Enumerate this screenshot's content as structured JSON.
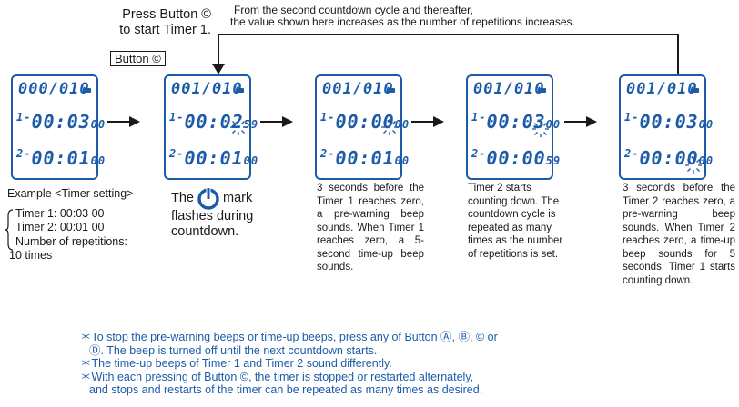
{
  "top": {
    "press_line1": "Press Button ©",
    "press_line2": "to start Timer 1.",
    "button_box": "Button ©",
    "note_line1": "From the second countdown cycle and thereafter,",
    "note_line2": "the value shown here increases as the number of repetitions increases."
  },
  "displays": [
    {
      "row1": "000/010",
      "row2_prefix": "1-",
      "row2_main": "00:03",
      "row2_sub": "00",
      "row3_prefix": "2-",
      "row3_main": "00:01",
      "row3_sub": "00"
    },
    {
      "row1": "001/010",
      "row2_prefix": "1-",
      "row2_main": "00:02",
      "row2_sub": "59",
      "row3_prefix": "2-",
      "row3_main": "00:01",
      "row3_sub": "00"
    },
    {
      "row1": "001/010",
      "row2_prefix": "1-",
      "row2_main": "00:00",
      "row2_sub": "00",
      "row3_prefix": "2-",
      "row3_main": "00:01",
      "row3_sub": "00"
    },
    {
      "row1": "001/010",
      "row2_prefix": "1-",
      "row2_main": "00:03",
      "row2_sub": "00",
      "row3_prefix": "2-",
      "row3_main": "00:00",
      "row3_sub": "59"
    },
    {
      "row1": "001/010",
      "row2_prefix": "1-",
      "row2_main": "00:03",
      "row2_sub": "00",
      "row3_prefix": "2-",
      "row3_main": "00:00",
      "row3_sub": "00"
    }
  ],
  "example": {
    "title": "Example <Timer setting>",
    "lines": [
      "Timer 1: 00:03 00",
      "Timer 2: 00:01 00",
      "Number of repetitions:",
      "10 times"
    ]
  },
  "mark_caption": {
    "the": "The",
    "mark": "mark",
    "line2": "flashes during",
    "line3": "countdown."
  },
  "captions": [
    "3 seconds before the Timer 1 reaches zero, a pre-warning beep sounds. When Timer 1 reaches zero, a 5-second time-up beep sounds.",
    "Timer 2 starts counting down. The countdown cycle is repeated as many times as the number of repetitions is set.",
    "3 seconds before the Timer 2 reaches zero, a pre-warning beep sounds. When Timer 2 reaches zero, a time-up beep sounds for 5 seconds. Timer 1 starts counting down."
  ],
  "notes": [
    "＊To stop the pre-warning beeps or time-up beeps, press any of Button Ⓐ, Ⓑ, © or",
    "Ⓓ. The beep is turned off until the next countdown starts.",
    "＊The time-up beeps of Timer 1 and Timer 2 sound differently.",
    "＊With each pressing of Button ©, the timer is stopped or restarted alternately,",
    "and stops and restarts of the timer can be repeated as many times as desired."
  ],
  "colors": {
    "accent": "#1b5ba8",
    "text": "#1a1a1a"
  }
}
